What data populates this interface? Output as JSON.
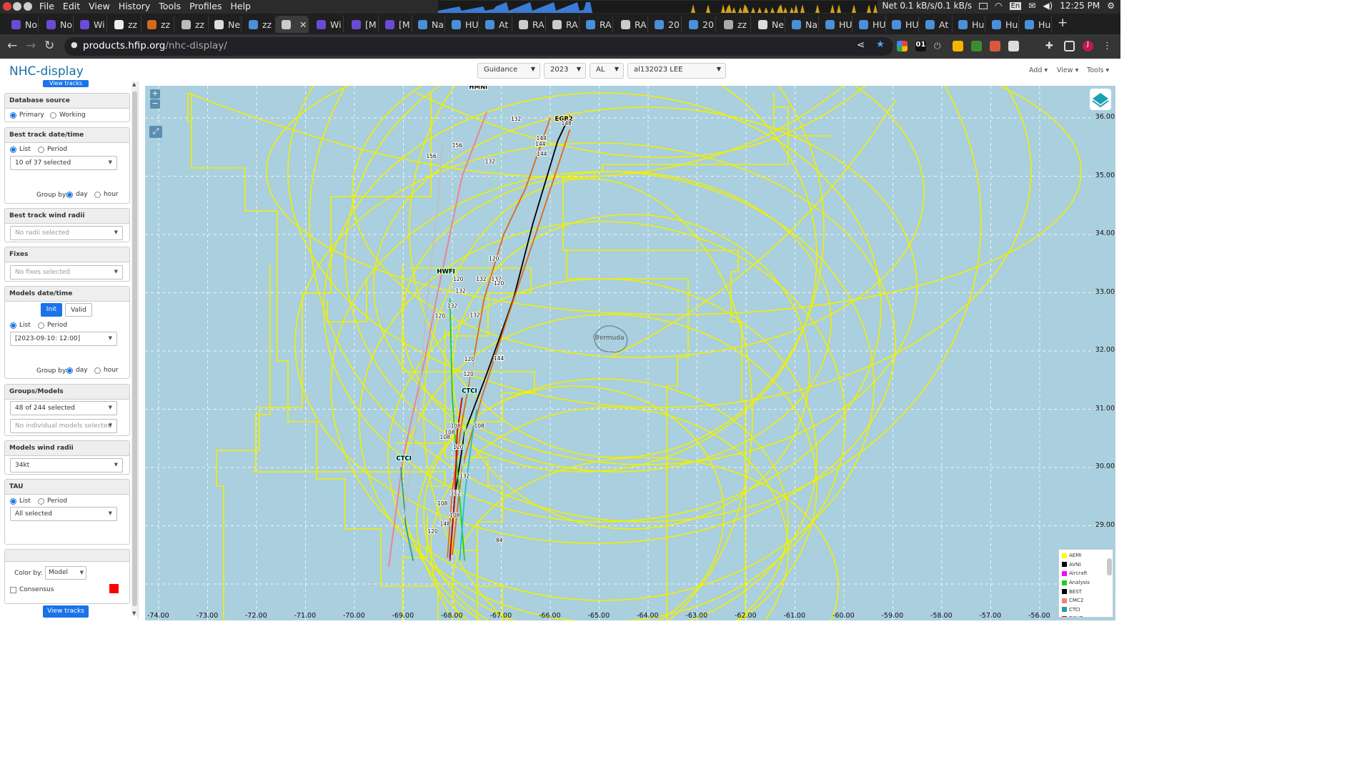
{
  "os": {
    "menu": [
      "File",
      "Edit",
      "View",
      "History",
      "Tools",
      "Profiles",
      "Help"
    ],
    "net": "Net 0.1 kB/s/0.1 kB/s",
    "lang": "En",
    "clock": "12:25 PM"
  },
  "tabs": [
    {
      "label": "No",
      "color": "#6b4bd6"
    },
    {
      "label": "No",
      "color": "#6b4bd6"
    },
    {
      "label": "Wi",
      "color": "#6b4bd6"
    },
    {
      "label": "zz",
      "color": "#eeeeee"
    },
    {
      "label": "zz",
      "color": "#d2691e"
    },
    {
      "label": "zz",
      "color": "#bbbbbb"
    },
    {
      "label": "Ne",
      "color": "#dddddd"
    },
    {
      "label": "zz",
      "color": "#4a90d9"
    },
    {
      "label": "",
      "color": "#cccccc"
    },
    {
      "label": "Wi",
      "color": "#6b4bd6"
    },
    {
      "label": "[M",
      "color": "#6b4bd6"
    },
    {
      "label": "[M",
      "color": "#6b4bd6"
    },
    {
      "label": "Na",
      "color": "#4a90d9"
    },
    {
      "label": "HU",
      "color": "#4a90d9"
    },
    {
      "label": "At",
      "color": "#4a90d9"
    },
    {
      "label": "RA",
      "color": "#cccccc"
    },
    {
      "label": "RA",
      "color": "#cccccc"
    },
    {
      "label": "RA",
      "color": "#4a90d9"
    },
    {
      "label": "RA",
      "color": "#cccccc"
    },
    {
      "label": "20",
      "color": "#4a90d9"
    },
    {
      "label": "20",
      "color": "#4a90d9"
    },
    {
      "label": "zz",
      "color": "#aaaaaa"
    },
    {
      "label": "Ne",
      "color": "#dddddd"
    },
    {
      "label": "Na",
      "color": "#4a90d9"
    },
    {
      "label": "HU",
      "color": "#4a90d9"
    },
    {
      "label": "HU",
      "color": "#4a90d9"
    },
    {
      "label": "HU",
      "color": "#4a90d9"
    },
    {
      "label": "At",
      "color": "#4a90d9"
    },
    {
      "label": "Hu",
      "color": "#4a90d9"
    },
    {
      "label": "Hu",
      "color": "#4a90d9"
    },
    {
      "label": "Hu",
      "color": "#4a90d9"
    }
  ],
  "address": {
    "host": "products.hfip.org",
    "path": "/nhc-display/"
  },
  "app": {
    "title": "NHC-display",
    "selects": [
      "Guidance",
      "2023",
      "AL",
      "al132023 LEE"
    ],
    "menus": [
      "Add",
      "View",
      "Tools"
    ]
  },
  "sidebar": {
    "view_tracks_top": "View tracks",
    "database_source": {
      "title": "Database source",
      "primary": "Primary",
      "working": "Working"
    },
    "best_track": {
      "title": "Best track date/time",
      "list": "List",
      "period": "Period",
      "selected": "10 of 37 selected",
      "group_by": "Group by:",
      "day": "day",
      "hour": "hour"
    },
    "best_track_radii": {
      "title": "Best track wind radii",
      "placeholder": "No radii selected"
    },
    "fixes": {
      "title": "Fixes",
      "placeholder": "No fixes selected"
    },
    "models_dt": {
      "title": "Models date/time",
      "init": "Init",
      "valid": "Valid",
      "list": "List",
      "period": "Period",
      "selected": "[2023-09-10: 12:00]",
      "group_by": "Group by:",
      "day": "day",
      "hour": "hour"
    },
    "groups_models": {
      "title": "Groups/Models",
      "selected": "48 of 244 selected",
      "individual": "No individual models selected"
    },
    "models_wind_radii": {
      "title": "Models wind radii",
      "selected": "34kt"
    },
    "tau": {
      "title": "TAU",
      "list": "List",
      "period": "Period",
      "selected": "All selected"
    },
    "color_by": {
      "label": "Color by:",
      "value": "Model",
      "consensus": "Consensus",
      "consensus_color": "#ff0000"
    },
    "view_tracks_bottom": "View tracks"
  },
  "map": {
    "lat_labels": [
      "36.00",
      "35.00",
      "34.00",
      "33.00",
      "32.00",
      "31.00",
      "30.00",
      "29.00"
    ],
    "lon_labels": [
      "-74.00",
      "-73.00",
      "-72.00",
      "-71.00",
      "-70.00",
      "-69.00",
      "-68.00",
      "-67.00",
      "-66.00",
      "-65.00",
      "-64.00",
      "-63.00",
      "-62.00",
      "-61.00",
      "-60.00",
      "-59.00",
      "-58.00",
      "-57.00",
      "-56.00"
    ],
    "place_label": "Bermuda",
    "model_labels": [
      "EGR2",
      "HWFI",
      "CTCI",
      "HMNI",
      "CTCI"
    ],
    "tau_labels": [
      "132",
      "156",
      "132",
      "144",
      "144",
      "148",
      "144",
      "120",
      "132",
      "120",
      "132",
      "120",
      "132",
      "132",
      "120",
      "120",
      "144",
      "120",
      "108",
      "108",
      "120",
      "108",
      "108",
      "132",
      "108",
      "108",
      "84",
      "120",
      "148",
      "156",
      "132",
      "112"
    ],
    "legend": [
      {
        "name": "AEMI",
        "color": "#ffff00"
      },
      {
        "name": "AVNI",
        "color": "#000000"
      },
      {
        "name": "Aircraft",
        "color": "#ff00ff"
      },
      {
        "name": "Analysis",
        "color": "#22cc22"
      },
      {
        "name": "BEST",
        "color": "#000000"
      },
      {
        "name": "CMC2",
        "color": "#f08080"
      },
      {
        "name": "CTCI",
        "color": "#20a0a0"
      },
      {
        "name": "DSHP",
        "color": "#cc0000"
      }
    ]
  }
}
